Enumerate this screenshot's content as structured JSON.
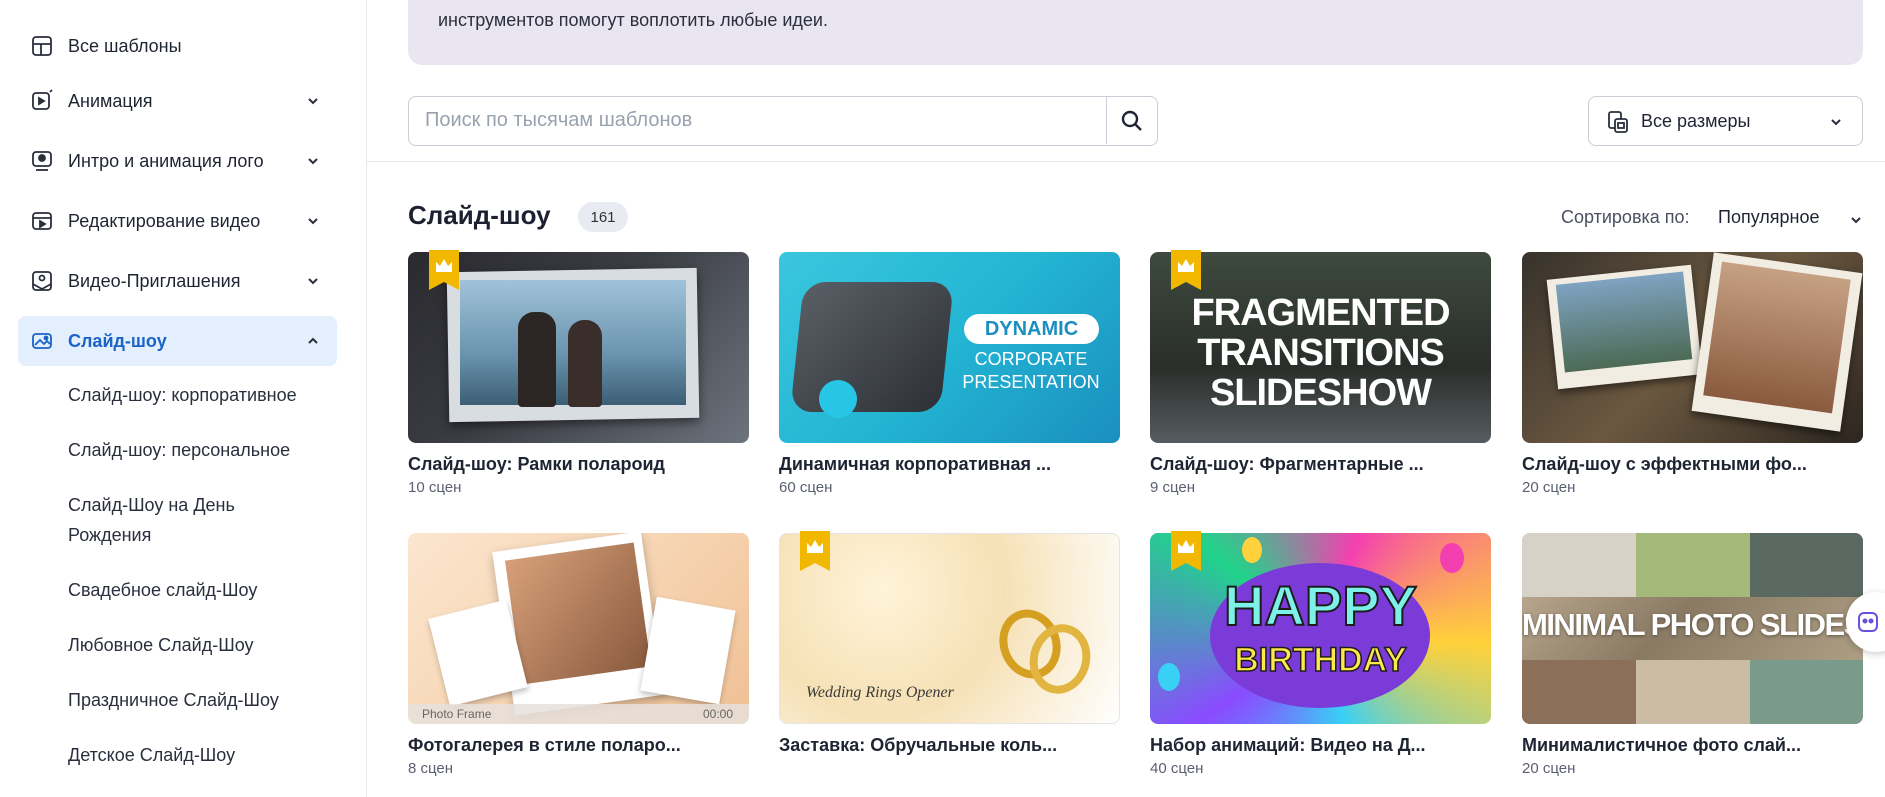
{
  "sidebar": {
    "items": [
      {
        "label": "Все шаблоны",
        "icon": "grid-template-icon",
        "chevron": null
      },
      {
        "label": "Анимация",
        "icon": "play-square-icon",
        "chevron": "down"
      },
      {
        "label": "Интро и анимация лого",
        "icon": "logo-intro-icon",
        "chevron": "down"
      },
      {
        "label": "Редактирование видео",
        "icon": "video-edit-icon",
        "chevron": "down"
      },
      {
        "label": "Видео-Приглашения",
        "icon": "invitation-icon",
        "chevron": "down"
      },
      {
        "label": "Слайд-шоу",
        "icon": "slideshow-icon",
        "chevron": "up",
        "active": true
      }
    ],
    "sub_items": [
      "Слайд-шоу: корпоративное",
      "Слайд-шоу: персональное",
      "Слайд-Шоу на День",
      "Рождения",
      "Свадебное слайд-Шоу",
      "Любовное Слайд-Шоу",
      "Праздничное Слайд-Шоу",
      "Детское Слайд-Шоу"
    ]
  },
  "banner": {
    "text": "инструментов помогут воплотить любые идеи."
  },
  "search": {
    "placeholder": "Поиск по тысячам шаблонов",
    "icon": "search-icon"
  },
  "sizes": {
    "label": "Все размеры",
    "icon": "sizes-icon"
  },
  "section": {
    "title": "Слайд-шоу",
    "count": "161"
  },
  "sort": {
    "label": "Сортировка по:",
    "value": "Популярное"
  },
  "cards": [
    {
      "title": "Слайд-шоу: Рамки полароид",
      "scenes": "10 сцен",
      "premium": true
    },
    {
      "title": "Динамичная корпоративная ...",
      "scenes": "60 сцен",
      "premium": false,
      "thumb_text": [
        "DYNAMIC",
        "CORPORATE",
        "PRESENTATION"
      ]
    },
    {
      "title": "Слайд-шоу: Фрагментарные ...",
      "scenes": "9 сцен",
      "premium": true,
      "thumb_text": [
        "FRAGMENTED",
        "TRANSITIONS",
        "SLIDESHOW"
      ]
    },
    {
      "title": "Слайд-шоу с эффектными фо...",
      "scenes": "20 сцен",
      "premium": false
    },
    {
      "title": "Фотогалерея в стиле полаpo...",
      "scenes": "8 сцен",
      "premium": false,
      "thumb_text": [
        "Photo Frame",
        "00:00"
      ]
    },
    {
      "title": "Заставка: Обручальные коль...",
      "scenes": "",
      "premium": true,
      "thumb_text": [
        "Wedding Rings Opener"
      ]
    },
    {
      "title": "Набор анимаций: Видео на Д...",
      "scenes": "40 сцен",
      "premium": true,
      "thumb_text": [
        "HAPPY",
        "BIRTHDAY"
      ]
    },
    {
      "title": "Минималистичное фото слай...",
      "scenes": "20 сцен",
      "premium": false,
      "thumb_text": [
        "MINIMAL PHOTO SLIDESHOW"
      ]
    }
  ],
  "colors": {
    "accent": "#1a63c7",
    "active_bg": "#e3effc",
    "banner_bg": "#e9e6f1",
    "crown": "#f2b800"
  }
}
